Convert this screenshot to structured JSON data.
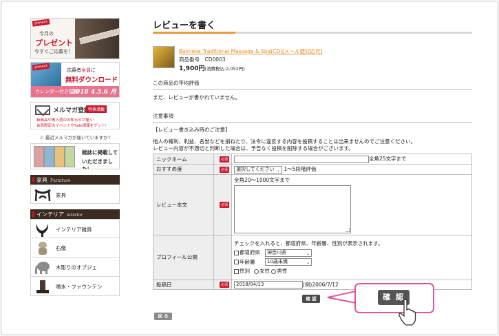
{
  "sidebar": {
    "banner_present": {
      "tag": "present",
      "line1": "今月の",
      "line2": "プレゼント",
      "line3": "今すぐご応募を!"
    },
    "banner_calendar": {
      "tag": "present",
      "line1_prefix": "応募者",
      "line1_accent": "全員",
      "line1_suffix": "に",
      "line2": "無料ダウンロード",
      "bar_text": "カレンダー付き壁紙",
      "bar_date": "2018 4.5.6 月"
    },
    "banner_mailmag": {
      "title": "メルマガ登録",
      "badge": "特典満載",
      "line1": "新商品や再入荷のお知らせが届く!",
      "line2": "会員限定のイベントやSale情報をゲット!"
    },
    "warn_link": "最近メルマガが届いていますか?",
    "banner_magazine": {
      "line1": "雑誌に掲載して",
      "line2": "いただきました!"
    },
    "categories": [
      {
        "title": "家具",
        "subtitle": "Furniture",
        "items": [
          "家具"
        ]
      },
      {
        "title": "インテリア",
        "subtitle": "interior",
        "items": [
          "インテリア雑貨",
          "石像",
          "木彫りのオブジェ",
          "噴水・ファウンテン"
        ]
      }
    ]
  },
  "main": {
    "page_title": "レビューを書く",
    "product": {
      "name": "Balinese Traditional Massage & Spa(CD)[メール便対応可]",
      "code": "商品番号　CD0003",
      "price": "1,900円",
      "price_tax": "(消費税込:2,052円)"
    },
    "average_heading": "この商品の平均評価",
    "no_review_text": "まだ、レビューが書かれていません。",
    "notes_heading": "注意事項",
    "notes_title": "【レビュー書き込み時のご注意】",
    "notes_line1": "他人の権利、利益、名誉などを損ねたり、法令に違反する内容を投稿することは出来ませんのでご注意ください。",
    "notes_line2": "レビュー内容が不適切と判断した場合は、予告なく投稿を削除する場合がございます。",
    "required_badge": "必須",
    "form": {
      "nickname_label": "ニックネーム",
      "nickname_hint": "全角25文字まで",
      "rating_label": "おすすめ度",
      "rating_value": "選択してください",
      "rating_hint": "1〜5段階評価",
      "body_label": "レビュー本文",
      "body_hint": "全角20〜1000文字まで",
      "profile_label": "プロフィール公開",
      "profile_hint": "チェックを入れると、都道府県、年齢層、性別が表示されます。",
      "pref_label": "都道府県",
      "pref_value": "神奈川県",
      "age_label": "年齢層",
      "age_value": "10歳未満",
      "gender_label": "性別",
      "gender_female": "女性",
      "gender_male": "男性",
      "date_label": "投稿日",
      "date_value": "2018/04/13",
      "date_hint": "(例)2006/7/12"
    },
    "confirm_label": "確 認",
    "back_label": "戻 る"
  },
  "callout": {
    "confirm_label": "確 認"
  },
  "colors": {
    "accent_orange": "#e89a3a",
    "required_red": "#c8182d",
    "callout_pink": "#e0559c",
    "link_orange": "#e8891f"
  }
}
